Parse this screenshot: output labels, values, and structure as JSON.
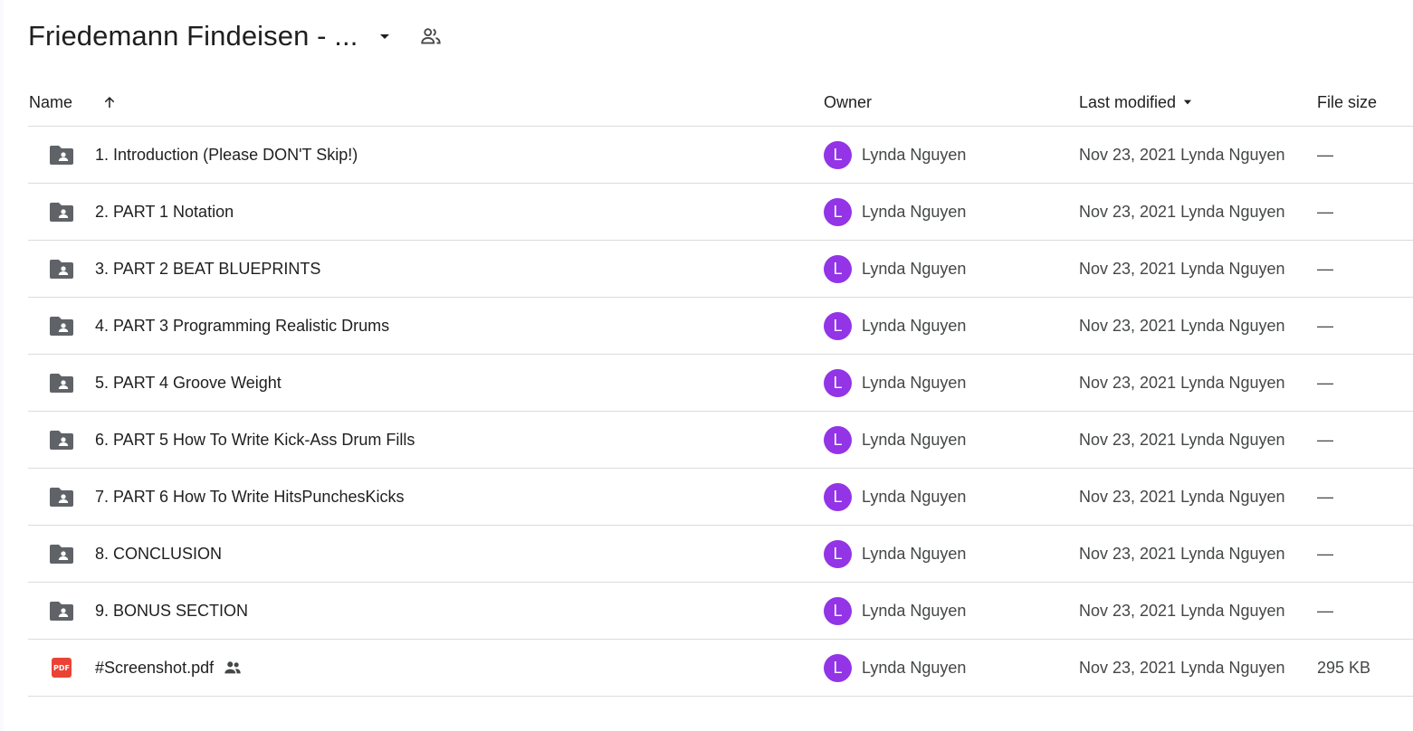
{
  "header": {
    "title": "Friedemann Findeisen - ...",
    "caret_icon": "arrow-drop-down-icon",
    "shared_icon": "people-icon"
  },
  "columns": {
    "name": "Name",
    "owner": "Owner",
    "last_modified": "Last modified",
    "file_size": "File size"
  },
  "colors": {
    "avatar": "#9334e6",
    "folder_icon": "#5f6368",
    "pdf_icon": "#ea4335",
    "divider": "#dadce0"
  },
  "rows": [
    {
      "type": "folder",
      "name": "1. Introduction (Please DON'T Skip!)",
      "owner_initial": "L",
      "owner": "Lynda Nguyen",
      "modified": "Nov 23, 2021 Lynda Nguyen",
      "size": "—"
    },
    {
      "type": "folder",
      "name": "2. PART 1 Notation",
      "owner_initial": "L",
      "owner": "Lynda Nguyen",
      "modified": "Nov 23, 2021 Lynda Nguyen",
      "size": "—"
    },
    {
      "type": "folder",
      "name": "3. PART 2 BEAT BLUEPRINTS",
      "owner_initial": "L",
      "owner": "Lynda Nguyen",
      "modified": "Nov 23, 2021 Lynda Nguyen",
      "size": "—"
    },
    {
      "type": "folder",
      "name": "4. PART 3 Programming Realistic Drums",
      "owner_initial": "L",
      "owner": "Lynda Nguyen",
      "modified": "Nov 23, 2021 Lynda Nguyen",
      "size": "—"
    },
    {
      "type": "folder",
      "name": "5. PART 4 Groove Weight",
      "owner_initial": "L",
      "owner": "Lynda Nguyen",
      "modified": "Nov 23, 2021 Lynda Nguyen",
      "size": "—"
    },
    {
      "type": "folder",
      "name": "6. PART 5 How To Write Kick-Ass Drum Fills",
      "owner_initial": "L",
      "owner": "Lynda Nguyen",
      "modified": "Nov 23, 2021 Lynda Nguyen",
      "size": "—"
    },
    {
      "type": "folder",
      "name": "7. PART 6 How To Write HitsPunchesKicks",
      "owner_initial": "L",
      "owner": "Lynda Nguyen",
      "modified": "Nov 23, 2021 Lynda Nguyen",
      "size": "—"
    },
    {
      "type": "folder",
      "name": "8. CONCLUSION",
      "owner_initial": "L",
      "owner": "Lynda Nguyen",
      "modified": "Nov 23, 2021 Lynda Nguyen",
      "size": "—"
    },
    {
      "type": "folder",
      "name": "9. BONUS SECTION",
      "owner_initial": "L",
      "owner": "Lynda Nguyen",
      "modified": "Nov 23, 2021 Lynda Nguyen",
      "size": "—"
    },
    {
      "type": "pdf",
      "name": "#Screenshot.pdf",
      "pdf_label": "PDF",
      "shared": true,
      "owner_initial": "L",
      "owner": "Lynda Nguyen",
      "modified": "Nov 23, 2021 Lynda Nguyen",
      "size": "295 KB"
    }
  ]
}
